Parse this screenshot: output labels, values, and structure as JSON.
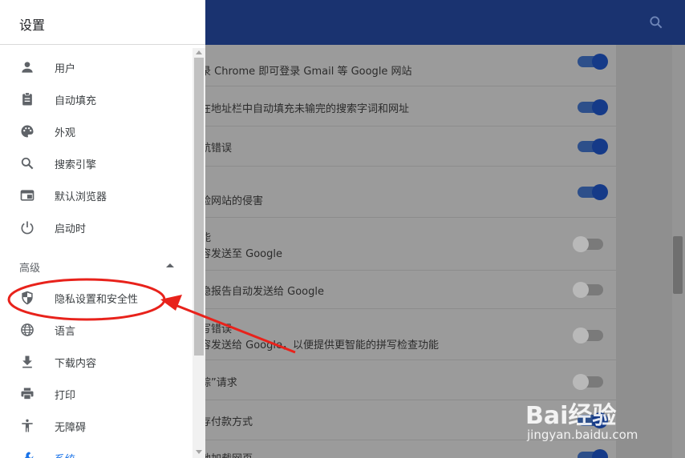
{
  "drawer": {
    "title": "设置",
    "items": [
      {
        "label": "用户",
        "icon": "person-icon"
      },
      {
        "label": "自动填充",
        "icon": "clipboard-icon"
      },
      {
        "label": "外观",
        "icon": "palette-icon"
      },
      {
        "label": "搜索引擎",
        "icon": "search-icon"
      },
      {
        "label": "默认浏览器",
        "icon": "browser-icon"
      },
      {
        "label": "启动时",
        "icon": "power-icon"
      }
    ],
    "advanced_label": "高级",
    "advanced_items": [
      {
        "label": "隐私设置和安全性",
        "icon": "shield-icon"
      },
      {
        "label": "语言",
        "icon": "globe-icon"
      },
      {
        "label": "下载内容",
        "icon": "download-icon"
      },
      {
        "label": "打印",
        "icon": "printer-icon"
      },
      {
        "label": "无障碍",
        "icon": "accessibility-icon"
      },
      {
        "label": "系统",
        "icon": "wrench-icon"
      }
    ]
  },
  "settings_rows": [
    {
      "text": "录 Chrome 即可登录 Gmail 等 Google 网站",
      "on": true
    },
    {
      "text": "在地址栏中自动填充未输完的搜索字词和网址",
      "on": true
    },
    {
      "text": "航错误",
      "on": true
    },
    {
      "text": "险网站的侵害",
      "on": true
    },
    {
      "text": "能",
      "text2": "容发送至 Google",
      "on": false
    },
    {
      "text": "隐报告自动发送给 Google",
      "on": false
    },
    {
      "text": "写错误",
      "text2": "容发送给 Google，以便提供更智能的拼写检查功能",
      "on": false
    },
    {
      "text": "踪”请求",
      "on": false
    },
    {
      "text": "存付款方式",
      "on": true
    },
    {
      "text": "地加载网页",
      "on": true
    }
  ],
  "colors": {
    "header": "#1a3370",
    "accent": "#1a73e8",
    "annotation": "#e8221b"
  },
  "watermark": {
    "logo": "Bai经验",
    "url": "jingyan.baidu.com"
  }
}
